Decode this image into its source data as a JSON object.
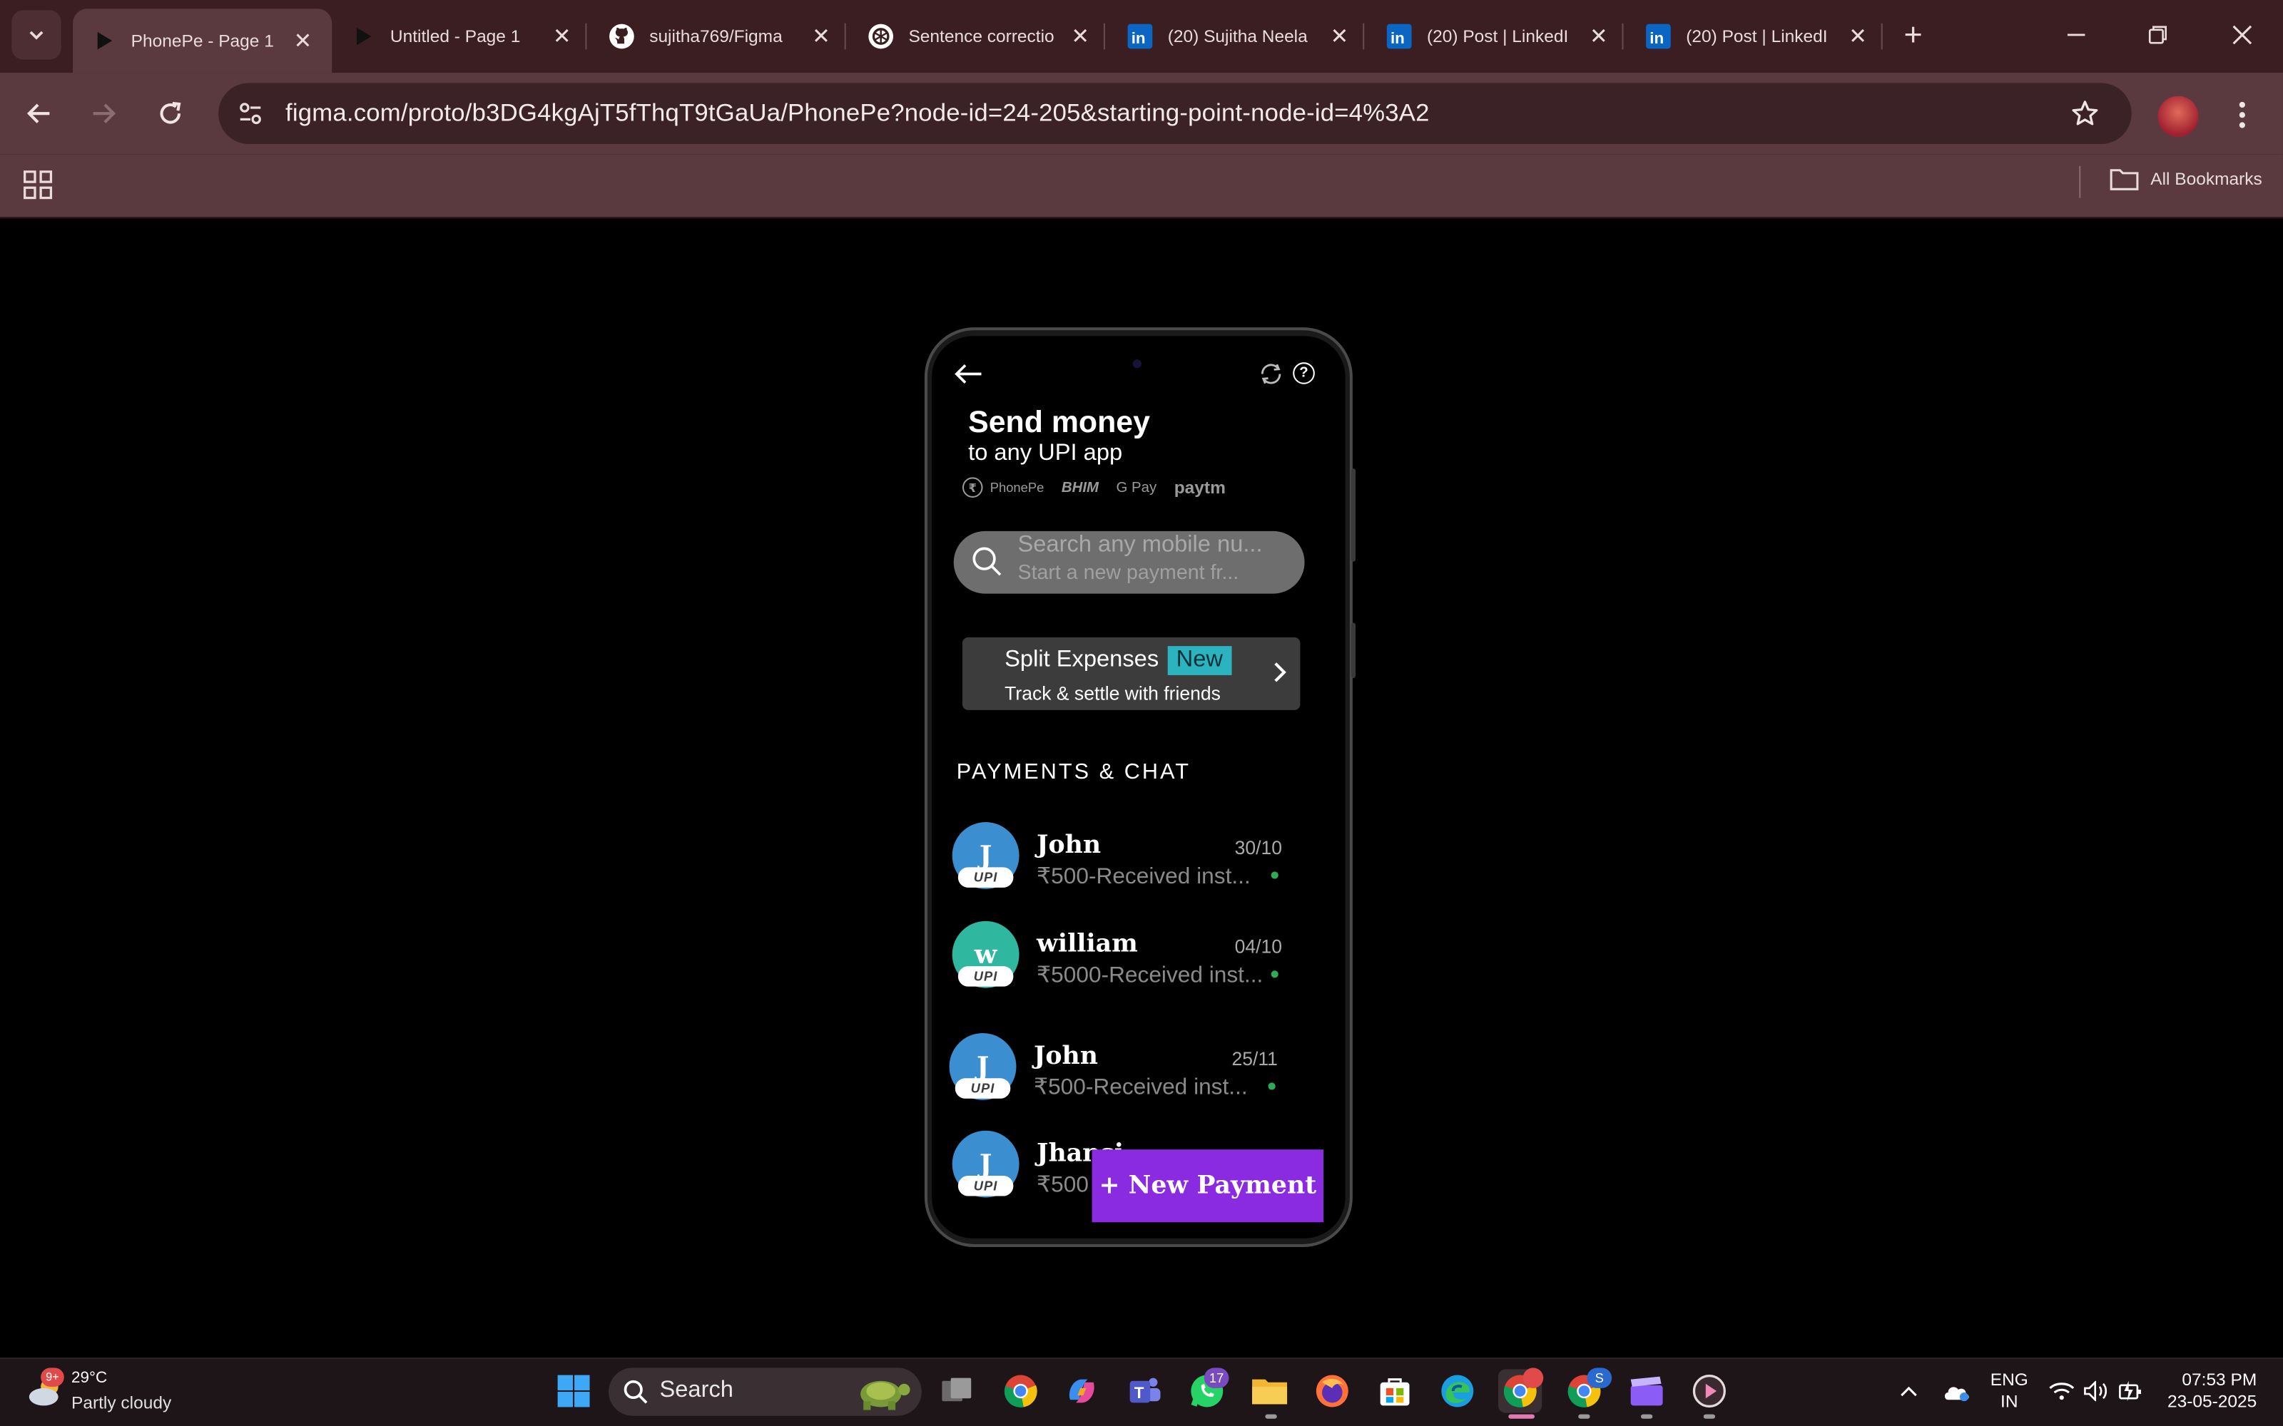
{
  "browser": {
    "tabs": [
      {
        "title": "PhonePe - Page 1",
        "icon": "figma-play-icon",
        "active": true
      },
      {
        "title": "Untitled - Page 1",
        "icon": "figma-play-icon",
        "active": false
      },
      {
        "title": "sujitha769/Figma",
        "icon": "github-icon",
        "active": false
      },
      {
        "title": "Sentence correctio",
        "icon": "openai-icon",
        "active": false
      },
      {
        "title": "(20) Sujitha Neela",
        "icon": "linkedin-icon",
        "active": false
      },
      {
        "title": "(20) Post | LinkedI",
        "icon": "linkedin-icon",
        "active": false
      },
      {
        "title": "(20) Post | LinkedI",
        "icon": "linkedin-icon",
        "active": false
      }
    ],
    "close_glyph": "✕",
    "new_tab_glyph": "+",
    "url": "figma.com/proto/b3DG4kgAjT5fThqT9tGaUa/PhonePe?node-id=24-205&starting-point-node-id=4%3A2",
    "bookmarks": {
      "all_label": "All Bookmarks"
    }
  },
  "phone": {
    "title": "Send money",
    "subtitle": "to any UPI app",
    "upi_apps": {
      "phonepe": "PhonePe",
      "bhim": "BHIM",
      "gpay": "G Pay",
      "paytm": "paytm"
    },
    "search": {
      "placeholder_line1": "Search any mobile nu...",
      "placeholder_line2": "Start a new payment fr..."
    },
    "split": {
      "title": "Split Expenses",
      "badge": "New",
      "subtitle": "Track & settle with friends"
    },
    "section_title": "PAYMENTS & CHAT",
    "upi_tag": "UPI",
    "contacts": [
      {
        "initial": "J",
        "name": "John",
        "date": "30/10",
        "message": "₹500-Received inst...",
        "color": "#3b8fd0"
      },
      {
        "initial": "w",
        "name": "william",
        "date": "04/10",
        "message": "₹5000-Received inst...",
        "color": "#2fb7a0"
      },
      {
        "initial": "J",
        "name": "John",
        "date": "25/11",
        "message": "₹500-Received inst...",
        "color": "#3b8fd0"
      },
      {
        "initial": "J",
        "name": "Jhansi",
        "date": "",
        "message": "₹500",
        "color": "#3b8fd0"
      }
    ],
    "new_payment_label": "+ New Payment",
    "accent": "#8a2be2"
  },
  "taskbar": {
    "weather": {
      "temp": "29°C",
      "desc": "Partly cloudy",
      "badge": "9+"
    },
    "search_label": "Search",
    "whatsapp_badge": "17",
    "chrome2_badge": "S",
    "lang_line1": "ENG",
    "lang_line2": "IN",
    "time": "07:53 PM",
    "date": "23-05-2025"
  }
}
